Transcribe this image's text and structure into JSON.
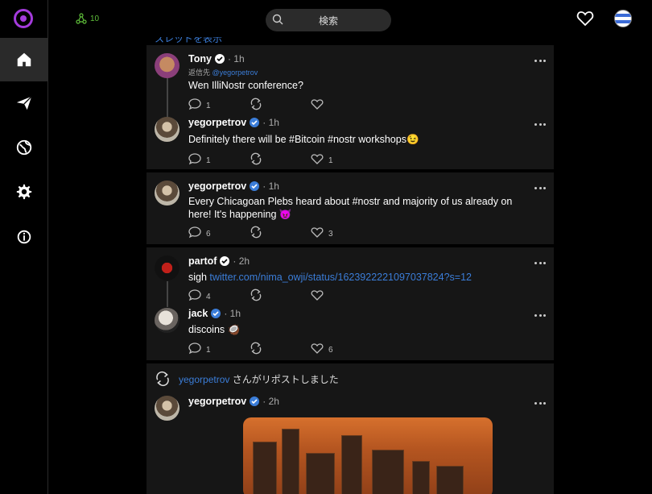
{
  "topbar": {
    "relay_count": "10",
    "search_placeholder": "検索"
  },
  "feed": {
    "thread_link": "スレッドを表示",
    "posts": [
      {
        "name": "Tony",
        "time": "· 1h",
        "reply_prefix": "返信先",
        "reply_to": "@yegorpetrov",
        "text": "Wen IlliNostr conference?",
        "replies": "1",
        "likes": ""
      },
      {
        "name": "yegorpetrov",
        "time": "· 1h",
        "text": "Definitely there will be #Bitcoin #nostr workshops😉",
        "replies": "1",
        "likes": "1"
      },
      {
        "name": "yegorpetrov",
        "time": "· 1h",
        "text": "Every Chicagoan Plebs heard about #nostr and majority of us already on here! It's happening 😈",
        "replies": "6",
        "likes": "3"
      },
      {
        "name": "partof",
        "time": "· 2h",
        "text_prefix": "sigh ",
        "link": "twitter.com/nima_owji/status/1623922221097037824?s=12",
        "replies": "4",
        "likes": ""
      },
      {
        "name": "jack",
        "time": "· 1h",
        "text": "discoins 🥥",
        "replies": "1",
        "likes": "6"
      },
      {
        "name": "yegorpetrov",
        "time": "· 2h"
      }
    ],
    "repost": {
      "who": "yegorpetrov",
      "suffix": "さんがリポストしました"
    }
  },
  "colors": {
    "accent": "#a43bdc",
    "link": "#3b7dd8",
    "relay": "#5fbf3a",
    "verified": "#3b7dd8"
  }
}
